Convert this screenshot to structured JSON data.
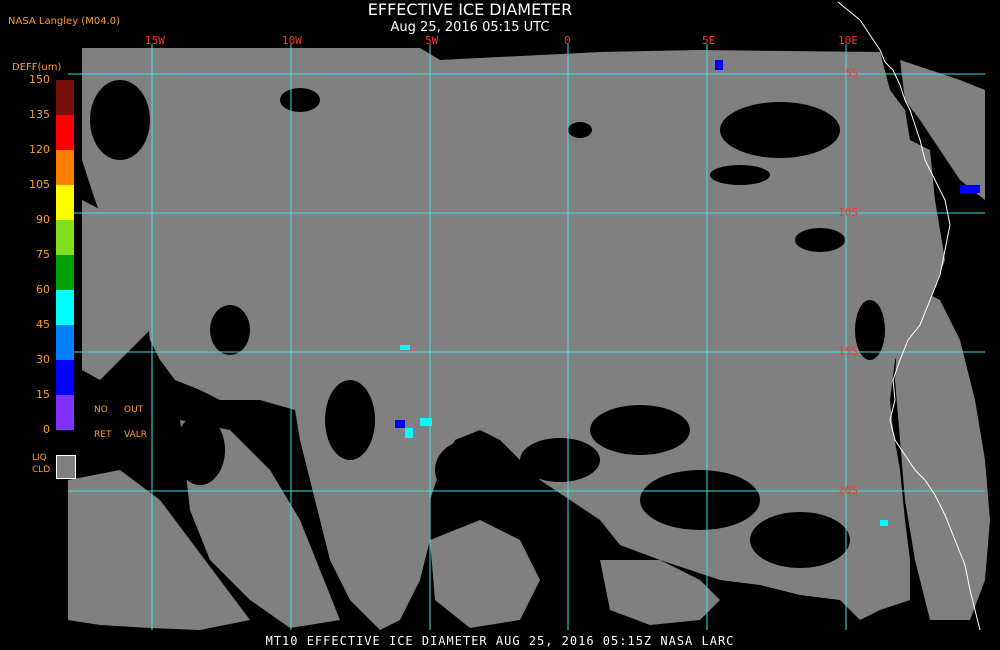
{
  "header": {
    "title": "EFFECTIVE ICE DIAMETER",
    "subtitle": "Aug 25, 2016 05:15 UTC",
    "producer": "NASA Langley (M04.0)"
  },
  "map": {
    "longitude_labels": [
      "15W",
      "10W",
      "5W",
      "0",
      "5E",
      "10E"
    ],
    "latitude_labels": [
      "5S",
      "10S",
      "15S",
      "20S"
    ],
    "colors": {
      "background": "#000000",
      "liquid_cloud": "#808080",
      "grid": "#40e0e0",
      "coastline": "#ffffff"
    }
  },
  "colorbar": {
    "title": "DEFF(um)",
    "ticks": [
      "150",
      "135",
      "120",
      "105",
      "90",
      "75",
      "60",
      "45",
      "30",
      "15",
      "0"
    ],
    "colors": [
      "#7a1010",
      "#b01010",
      "#ff0000",
      "#ff8000",
      "#ffff00",
      "#80e020",
      "#00a000",
      "#00ffff",
      "#0080ff",
      "#0000ff",
      "#8030ff"
    ],
    "no_ret_label_top": "NO",
    "no_ret_label_bottom": "RET",
    "out_valr_label_top": "OUT",
    "out_valr_label_bottom": "VALR",
    "liq_cld_label_top": "LIQ",
    "liq_cld_label_bottom": "CLD"
  },
  "footer": {
    "text": "MT10  EFFECTIVE ICE DIAMETER  AUG 25, 2016 05:15Z  NASA LARC"
  }
}
